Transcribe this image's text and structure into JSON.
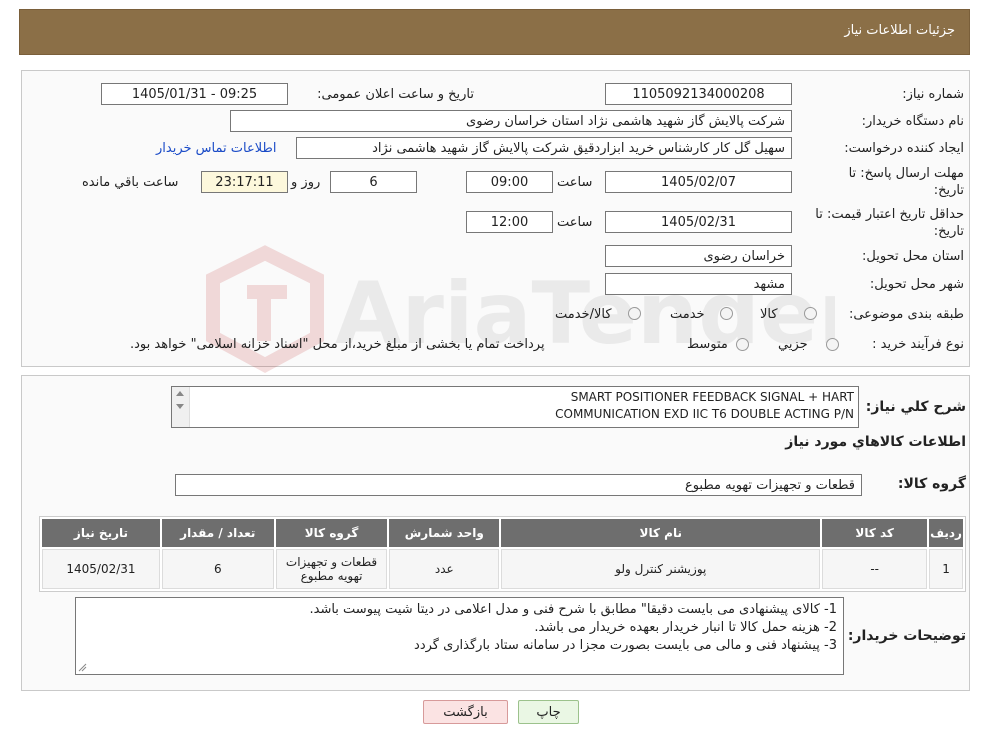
{
  "header": {
    "title": "جزئیات اطلاعات نیاز"
  },
  "info": {
    "need_number_label": "شماره نیاز:",
    "need_number": "1105092134000208",
    "announce_label": "تاریخ و ساعت اعلان عمومی:",
    "announce_value": "1405/01/31 - 09:25",
    "buyer_org_label": "نام دستگاه خریدار:",
    "buyer_org": "شرکت پالایش گاز شهید هاشمی نژاد   استان خراسان رضوی",
    "creator_label": "ایجاد کننده درخواست:",
    "creator": "سهیل گل کار کارشناس خرید ابزاردقیق شرکت پالایش گاز شهید هاشمی نژاد",
    "contact_link": "اطلاعات تماس خریدار",
    "deadline_label_1": "مهلت ارسال پاسخ: تا",
    "deadline_label_2": "تاریخ:",
    "deadline_date": "1405/02/07",
    "time_label": "ساعت",
    "deadline_time": "09:00",
    "days_value": "6",
    "days_label": "روز و",
    "remaining_time": "23:17:11",
    "remaining_label": "ساعت باقي مانده",
    "validity_label_1": "حداقل تاریخ اعتبار قیمت: تا",
    "validity_label_2": "تاریخ:",
    "validity_date": "1405/02/31",
    "validity_time_label": "ساعت",
    "validity_time": "12:00",
    "province_label": "استان محل تحویل:",
    "province": "خراسان رضوی",
    "city_label": "شهر محل تحویل:",
    "city": "مشهد",
    "category_label": "طبقه بندی موضوعی:",
    "category_options": [
      "کالا",
      "خدمت",
      "کالا/خدمت"
    ],
    "process_label": "نوع فرآیند خرید :",
    "process_options": [
      "جزيي",
      "متوسط"
    ],
    "process_note": "پرداخت تمام یا بخشی از مبلغ خرید،از محل \"اسناد خزانه اسلامی\" خواهد بود."
  },
  "summary": {
    "label": "شرح کلي نياز:",
    "line1": "SMART POSITIONER FEEDBACK SIGNAL + HART",
    "line2": "COMMUNICATION EXD IIC T6 DOUBLE ACTING P/N"
  },
  "goods_section_title": "اطلاعات کالاهاي مورد نياز",
  "goods_group": {
    "label": "گروه کالا:",
    "value": "قطعات و تجهیزات تهویه مطبوع"
  },
  "table": {
    "headers": [
      "رديف",
      "کد کالا",
      "نام کالا",
      "واحد شمارش",
      "گروه کالا",
      "تعداد / مقدار",
      "تاريخ نياز"
    ],
    "rows": [
      {
        "row": "1",
        "code": "--",
        "name": "پوزیشنر کنترل ولو",
        "unit": "عدد",
        "group": "قطعات و تجهیزات تهویه مطبوع",
        "qty": "6",
        "date": "1405/02/31"
      }
    ]
  },
  "notes": {
    "label": "توضیحات خریدار:",
    "lines": [
      "1-     کالای پیشنهادی می بایست دقیقا\" مطابق با شرح فنی و مدل اعلامی در دیتا شیت پیوست باشد.",
      "2-     هزینه حمل کالا تا انبار خریدار بعهده خریدار می باشد.",
      "3-     پیشنهاد فنی و مالی می بایست بصورت مجزا در سامانه ستاد بارگذاری گردد"
    ]
  },
  "buttons": {
    "print": "چاپ",
    "back": "بازگشت"
  },
  "watermark": {
    "text": "AriaTender.neT"
  },
  "colors": {
    "header_bg": "#8b6f47",
    "table_header_bg": "#6e6e6e",
    "link": "#1a4bc7"
  }
}
